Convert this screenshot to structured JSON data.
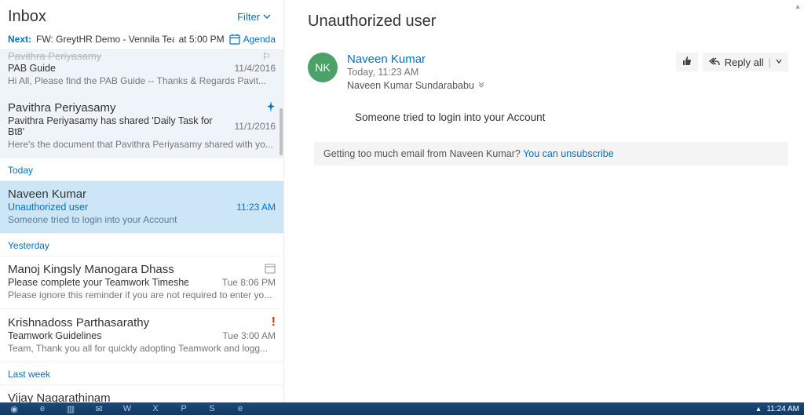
{
  "leftPane": {
    "title": "Inbox",
    "filterLabel": "Filter",
    "nextLabel": "Next:",
    "nextSubject": "FW: GreytHR Demo - Vennila Team",
    "nextTime": "at 5:00 PM",
    "agendaLabel": "Agenda"
  },
  "groups": {
    "today": "Today",
    "yesterday": "Yesterday",
    "lastWeek": "Last week"
  },
  "messages": {
    "m0": {
      "senderCut": "Pavithra Periyasamy",
      "subject": "PAB Guide",
      "time": "11/4/2016",
      "preview": "Hi All,   Please find the PAB Guide   -- Thanks & Regards Pavit..."
    },
    "m1": {
      "sender": "Pavithra Periyasamy",
      "subject": "Pavithra Periyasamy has shared 'Daily Task for Bt8'",
      "time": "11/1/2016",
      "preview": "Here's the document that Pavithra Periyasamy shared with yo..."
    },
    "m2": {
      "sender": "Naveen Kumar",
      "subject": "Unauthorized user",
      "time": "11:23 AM",
      "preview": "Someone tried to login into your Account"
    },
    "m3": {
      "sender": "Manoj Kingsly Manogara Dhass",
      "subject": "Please complete your Teamwork Timesheet entry now",
      "time": "Tue 8:06 PM",
      "preview": "Please ignore this reminder if you are not required to enter yo..."
    },
    "m4": {
      "sender": "Krishnadoss Parthasarathy",
      "subject": "Teamwork Guidelines",
      "time": "Tue 3:00 AM",
      "preview": "Team,  Thank you all for quickly adopting Teamwork and logg..."
    },
    "m5": {
      "sender": "Vijay Nagarathinam"
    }
  },
  "reading": {
    "subject": "Unauthorized user",
    "avatarInitials": "NK",
    "fromName": "Naveen Kumar",
    "fromDate": "Today, 11:23 AM",
    "toLine": "Naveen Kumar Sundarababu",
    "replyAllLabel": "Reply all",
    "bodyLine": "Someone tried to login into your Account",
    "unsubPrefix": "Getting too much email from Naveen Kumar? ",
    "unsubLink": "You can unsubscribe"
  },
  "taskbar": {
    "clock": "11:24 AM"
  },
  "colors": {
    "accent": "#0072c6",
    "pinnedBg": "#eef4fa",
    "selectedBg": "#cde6f7"
  }
}
